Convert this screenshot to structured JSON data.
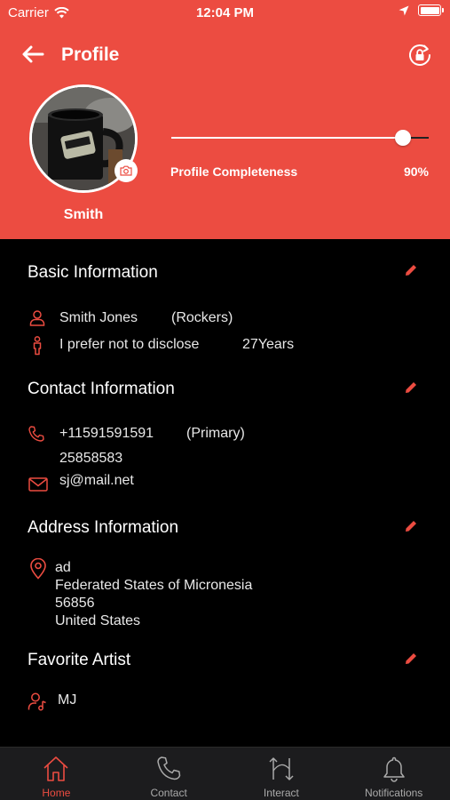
{
  "status_bar": {
    "carrier": "Carrier",
    "time": "12:04 PM"
  },
  "header": {
    "title": "Profile",
    "user_name": "Smith",
    "completeness_label": "Profile Completeness",
    "completeness_value": "90%",
    "completeness_fraction": 0.9
  },
  "basic": {
    "title": "Basic Information",
    "name": "Smith Jones",
    "group": "(Rockers)",
    "gender": "I prefer not to disclose",
    "age": "27Years"
  },
  "contact": {
    "title": "Contact Information",
    "phone": "+11591591591",
    "phone_tag": "(Primary)",
    "phone2": "25858583",
    "email": "sj@mail.net"
  },
  "address": {
    "title": "Address Information",
    "line1": "ad",
    "line2": "Federated States of Micronesia",
    "line3": "56856",
    "line4": "United States"
  },
  "artist": {
    "title": "Favorite Artist",
    "name": "MJ"
  },
  "tabs": [
    {
      "label": "Home",
      "icon": "home-icon",
      "active": true
    },
    {
      "label": "Contact",
      "icon": "phone-icon",
      "active": false
    },
    {
      "label": "Interact",
      "icon": "interact-arrows-icon",
      "active": false
    },
    {
      "label": "Notifications",
      "icon": "bell-icon",
      "active": false
    }
  ],
  "colors": {
    "accent": "#ec4c41",
    "background": "#000000",
    "tabbar": "#1c1c1e"
  }
}
